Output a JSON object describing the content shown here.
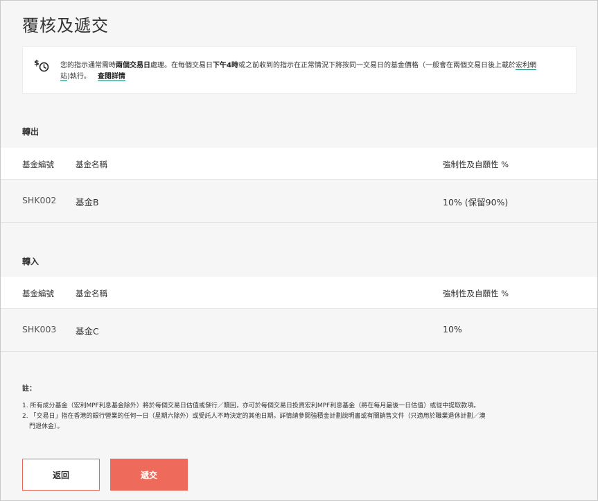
{
  "page": {
    "title": "覆核及遞交"
  },
  "info": {
    "text_1": "您的指示通常需時",
    "bold_1": "兩個交易日",
    "text_2": "處理。在每個交易日",
    "bold_2": "下午4時",
    "text_3": "或之前收到的指示在正常情況下將按同一交易日的基金價格（一般會在兩個交易日後上載於",
    "link_site_part1": "宏利網",
    "link_site_part2": "站",
    "text_4": ")執行。",
    "details_link": "查閱詳情"
  },
  "switch_out": {
    "heading": "轉出",
    "headers": {
      "code": "基金編號",
      "name": "基金名稱",
      "pct": "強制性及自願性 %"
    },
    "rows": [
      {
        "code": "SHK002",
        "name": "基金B",
        "pct": "10% (保留90%)"
      }
    ]
  },
  "switch_in": {
    "heading": "轉入",
    "headers": {
      "code": "基金編號",
      "name": "基金名稱",
      "pct": "強制性及自願性 %"
    },
    "rows": [
      {
        "code": "SHK003",
        "name": "基金C",
        "pct": "10%"
      }
    ]
  },
  "notes": {
    "title": "註：",
    "items": [
      "1. 所有成分基金（宏利MPF利息基金除外）將於每個交易日估值或發行／贖回，亦可於每個交易日投資宏利MPF利息基金（將在每月最後一日估值）或從中提取款項。",
      "2. 「交易日」指在香港的銀行營業的任何一日（星期六除外）或受託人不時決定的其他日期。詳情請參閱強積金計劃說明書或有關銷售文件（只適用於職業退休計劃／澳",
      "門退休金）。"
    ]
  },
  "buttons": {
    "back": "返回",
    "submit": "遞交"
  },
  "colors": {
    "accent": "#ee6b5b",
    "link_underline": "#0a7d6d"
  }
}
